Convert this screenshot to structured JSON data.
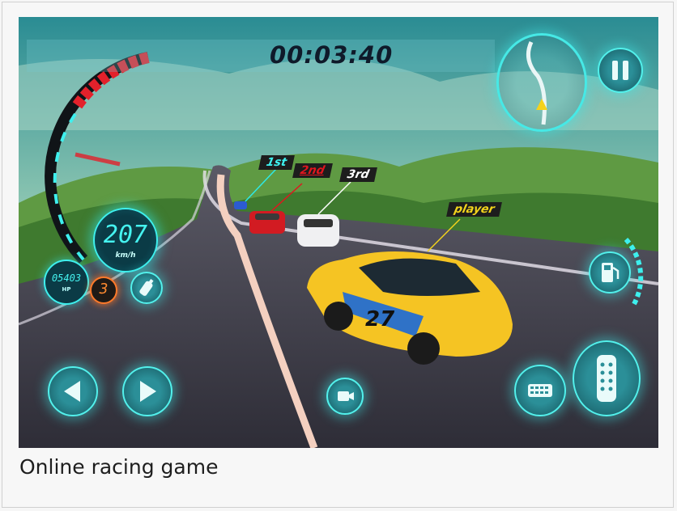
{
  "caption": "Online racing game",
  "hud": {
    "timer": "00:03:40",
    "speed_value": "207",
    "speed_unit": "km/h",
    "hp_value": "05403",
    "hp_unit": "HP",
    "gear": "3"
  },
  "positions": {
    "first": "1st",
    "second": "2nd",
    "third": "3rd",
    "player": "player"
  },
  "car_number": "27",
  "icons": {
    "pause": "pause-icon",
    "minimap": "track-minimap",
    "nitro": "nitro-bottle-icon",
    "steer_left": "arrow-left-icon",
    "steer_right": "arrow-right-icon",
    "camera": "camera-icon",
    "brake": "brake-pedal-icon",
    "gas": "gas-pedal-icon",
    "fuel": "fuel-pump-icon"
  },
  "colors": {
    "hud_cyan": "#3ef0ee",
    "speed_red": "#e3212b",
    "player_car": "#f5c423",
    "second_tag": "#e0161e",
    "player_tag": "#f2d31c"
  }
}
